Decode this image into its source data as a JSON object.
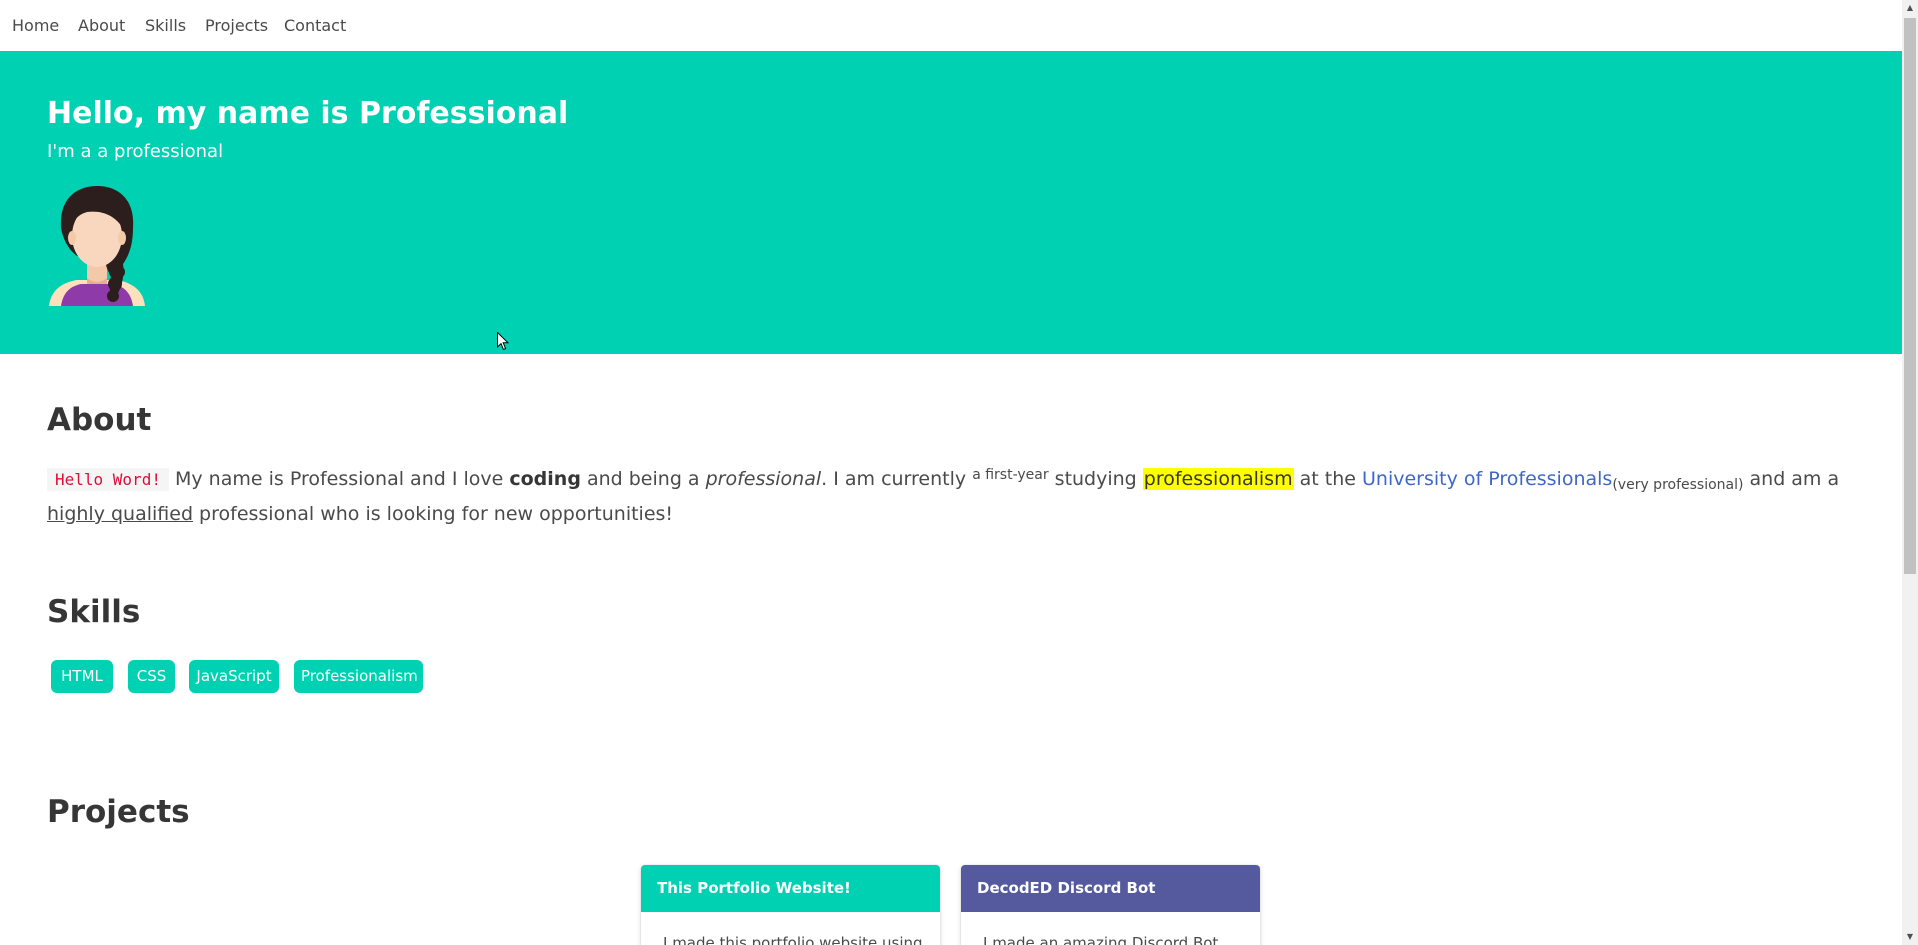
{
  "nav": {
    "items": [
      {
        "label": "Home"
      },
      {
        "label": "About"
      },
      {
        "label": "Skills"
      },
      {
        "label": "Projects"
      },
      {
        "label": "Contact"
      }
    ]
  },
  "hero": {
    "title": "Hello, my name is Professional",
    "subtitle": "I'm a a professional",
    "color": "#00d1b2"
  },
  "about": {
    "title": "About",
    "code": "Hello Word!",
    "t1": " My name is Professional and I love ",
    "coding": "coding",
    "t2": " and being a ",
    "professional": "professional",
    "t3": ". I am currently ",
    "sup": "a first-year",
    "t4": " studying ",
    "highlight": "professionalism",
    "t5": " at the ",
    "link": "University of Professionals",
    "sub": "(very professional)",
    "t6": " and am a ",
    "underline": "highly qualified",
    "t7": " professional who is looking for new opportunities!"
  },
  "skills": {
    "title": "Skills",
    "tags": [
      "HTML",
      "CSS",
      "JavaScript",
      "Professionalism"
    ]
  },
  "projects": {
    "title": "Projects",
    "cards": [
      {
        "title": "This Portfolio Website!",
        "color": "#00d1b2",
        "body": "I made this portfolio website using"
      },
      {
        "title": "DecodED Discord Bot",
        "color": "#555a9e",
        "body": "I made an amazing Discord Bot"
      }
    ]
  }
}
